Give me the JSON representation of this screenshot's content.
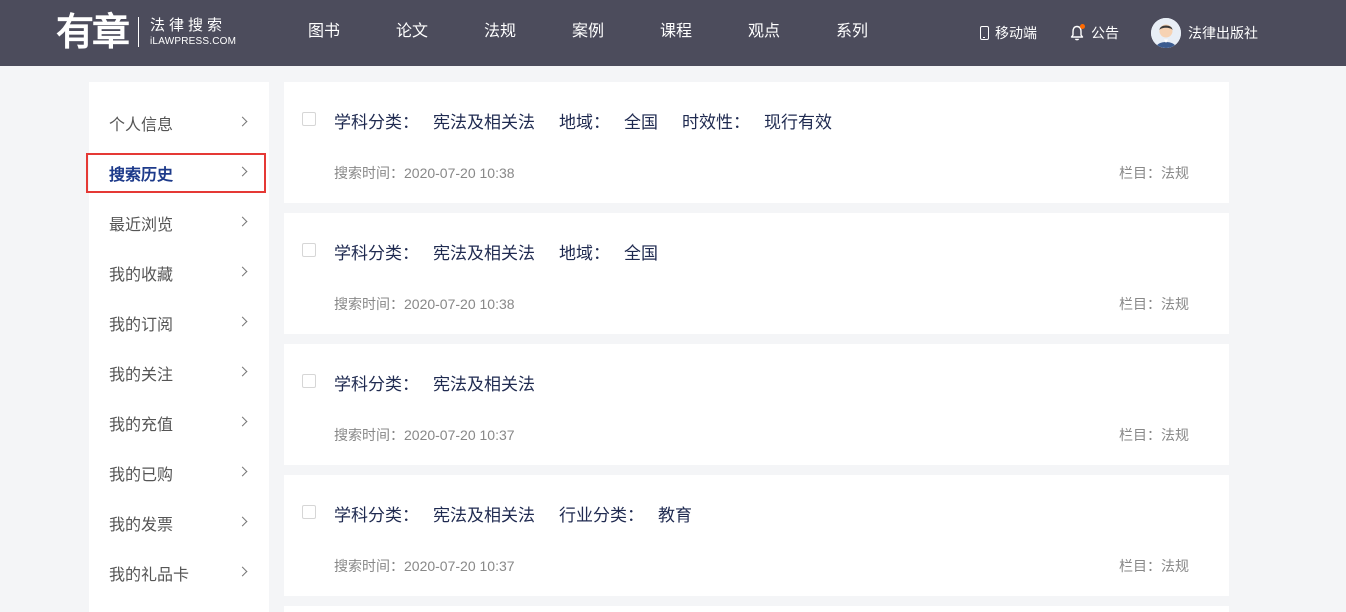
{
  "header": {
    "logo_mark": "有章",
    "logo_cn": "法律搜索",
    "logo_en": "iLAWPRESS.COM",
    "nav": [
      "图书",
      "论文",
      "法规",
      "案例",
      "课程",
      "观点",
      "系列"
    ],
    "mobile": "移动端",
    "notice": "公告",
    "user": "法律出版社"
  },
  "sidebar": {
    "items": [
      {
        "label": "个人信息"
      },
      {
        "label": "搜索历史",
        "active": true
      },
      {
        "label": "最近浏览"
      },
      {
        "label": "我的收藏"
      },
      {
        "label": "我的订阅"
      },
      {
        "label": "我的关注"
      },
      {
        "label": "我的充值"
      },
      {
        "label": "我的已购"
      },
      {
        "label": "我的发票"
      },
      {
        "label": "我的礼品卡"
      }
    ]
  },
  "history": [
    {
      "filters": [
        {
          "key": "学科分类：",
          "value": "宪法及相关法"
        },
        {
          "key": "地域：",
          "value": "全国"
        },
        {
          "key": "时效性：",
          "value": "现行有效"
        }
      ],
      "time": "搜索时间：2020-07-20 10:38",
      "column": "栏目：法规"
    },
    {
      "filters": [
        {
          "key": "学科分类：",
          "value": "宪法及相关法"
        },
        {
          "key": "地域：",
          "value": "全国"
        }
      ],
      "time": "搜索时间：2020-07-20 10:38",
      "column": "栏目：法规"
    },
    {
      "filters": [
        {
          "key": "学科分类：",
          "value": "宪法及相关法"
        }
      ],
      "time": "搜索时间：2020-07-20 10:37",
      "column": "栏目：法规"
    },
    {
      "filters": [
        {
          "key": "学科分类：",
          "value": "宪法及相关法"
        },
        {
          "key": "行业分类：",
          "value": "教育"
        }
      ],
      "time": "搜索时间：2020-07-20 10:37",
      "column": "栏目：法规"
    }
  ],
  "colors": {
    "header_bg": "#4c4c5c",
    "active_text": "#1d3a8a",
    "active_outline": "#e53935",
    "notice_dot": "#ff6a00"
  }
}
